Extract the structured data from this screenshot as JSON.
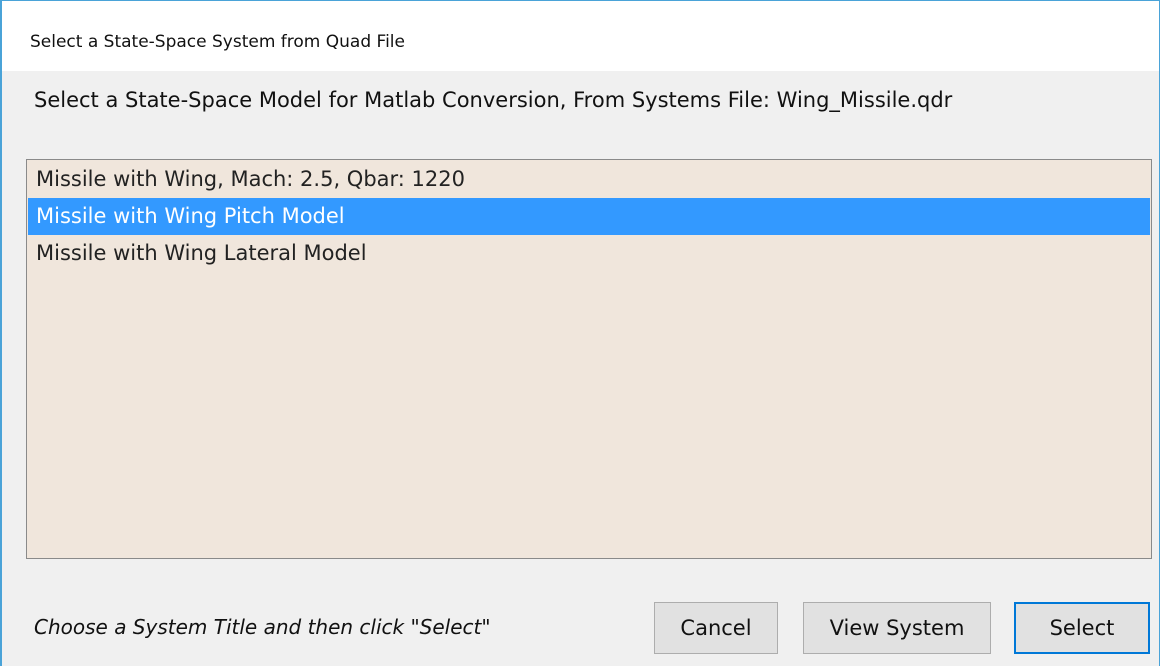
{
  "window": {
    "title": "Select a State-Space System from Quad File"
  },
  "prompt": {
    "text": "Select a State-Space Model for  Matlab Conversion,  From Systems File: Wing_Missile.qdr"
  },
  "list": {
    "items": [
      {
        "label": "Missile with Wing, Mach: 2.5, Qbar: 1220",
        "selected": false
      },
      {
        "label": "Missile with Wing Pitch Model",
        "selected": true
      },
      {
        "label": "Missile with Wing Lateral Model",
        "selected": false
      }
    ],
    "background_color": "#f0e6dc",
    "selection_color": "#3399ff"
  },
  "footer": {
    "hint": "Choose a System Title and then click \"Select\""
  },
  "buttons": {
    "cancel_label": "Cancel",
    "view_label": "View System",
    "select_label": "Select"
  }
}
